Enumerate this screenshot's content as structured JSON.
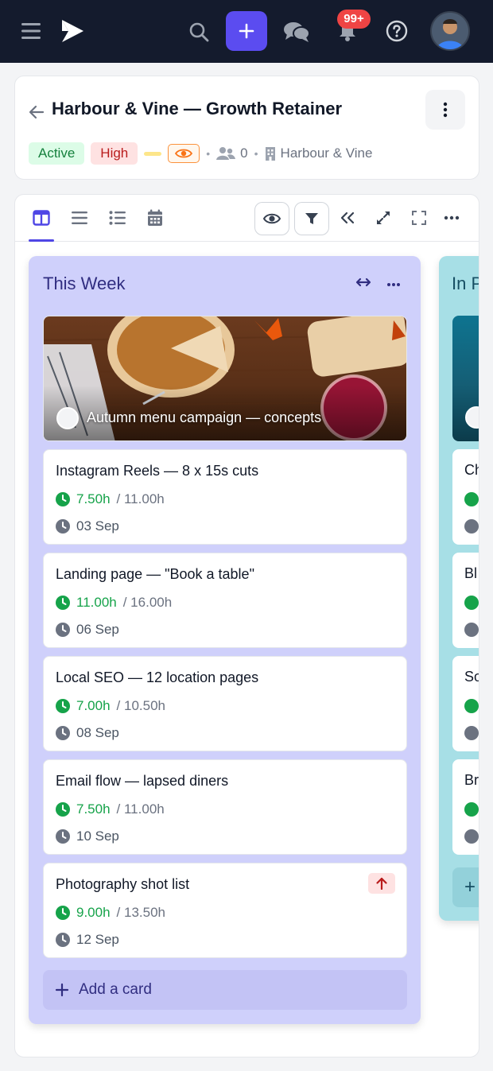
{
  "nav": {
    "notifications_badge": "99+",
    "icons": [
      "menu-icon",
      "logo-icon",
      "search-icon",
      "plus-icon",
      "chat-icon",
      "bell-icon",
      "help-icon"
    ]
  },
  "project": {
    "title": "Harbour & Vine — Growth Retainer",
    "status": "Active",
    "priority": "High",
    "members_count": "0",
    "client": "Harbour & Vine",
    "colors": {
      "status_bg": "#dcfce7",
      "status_text": "#15803d",
      "priority_bg": "#fee2e2",
      "priority_text": "#b91c1c"
    }
  },
  "toolbar": {
    "views": [
      "board-view-icon",
      "lines-view-icon",
      "list-view-icon",
      "calendar-view-icon"
    ],
    "active_view": "board",
    "actions": [
      "eye-icon",
      "filter-icon",
      "collapse-icon",
      "expand-icon",
      "fullscreen-icon",
      "more-icon"
    ]
  },
  "columns": [
    {
      "title": "This Week",
      "color": "#cfd0fb",
      "cover_card": {
        "title": "Autumn menu campaign — concepts"
      },
      "cards": [
        {
          "title": "Instagram Reels — 8 x 15s cuts",
          "logged": "7.50h",
          "estimate": "/ 11.00h",
          "due": "03 Sep"
        },
        {
          "title": "Landing page — \"Book a table\"",
          "logged": "11.00h",
          "estimate": "/ 16.00h",
          "due": "06 Sep"
        },
        {
          "title": "Local SEO — 12 location pages",
          "logged": "7.00h",
          "estimate": "/ 10.50h",
          "due": "08 Sep"
        },
        {
          "title": "Email flow — lapsed diners",
          "logged": "7.50h",
          "estimate": "/ 11.00h",
          "due": "10 Sep"
        },
        {
          "title": "Photography shot list",
          "logged": "9.00h",
          "estimate": "/ 13.50h",
          "due": "12 Sep",
          "priority": "high"
        }
      ],
      "add_card_label": "Add a card"
    },
    {
      "title": "In P",
      "color": "#a7dfe6",
      "cards": [
        {
          "title": "Ch"
        },
        {
          "title": "Bl"
        },
        {
          "title": "So"
        },
        {
          "title": "Br"
        }
      ],
      "add_card_label": "+"
    }
  ]
}
